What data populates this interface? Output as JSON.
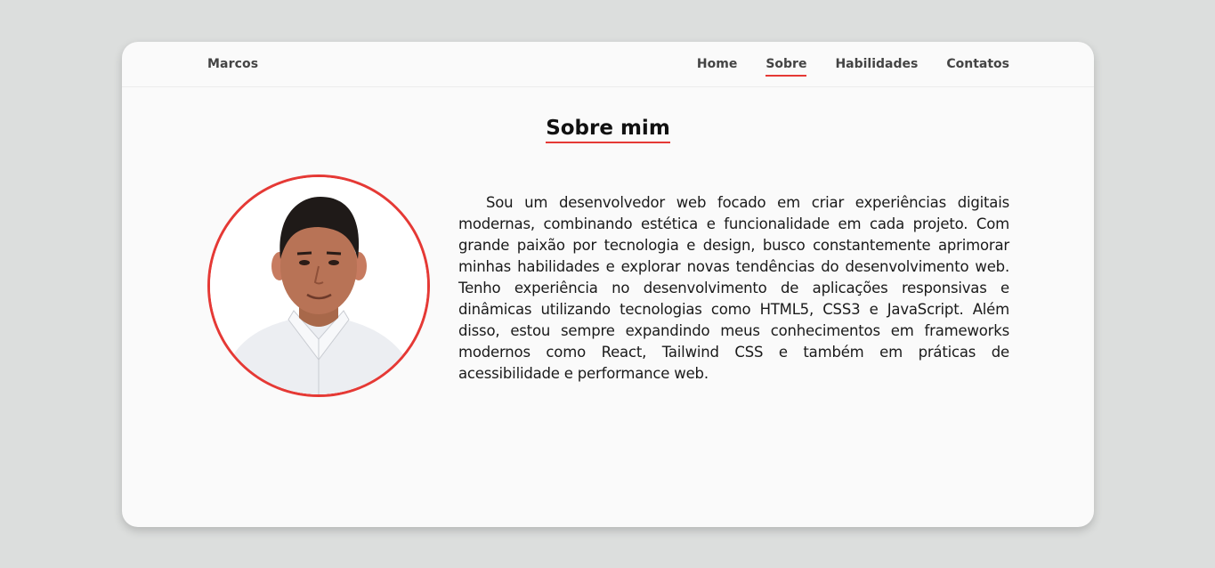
{
  "header": {
    "brand": "Marcos",
    "nav": [
      {
        "label": "Home",
        "active": false
      },
      {
        "label": "Sobre",
        "active": true
      },
      {
        "label": "Habilidades",
        "active": false
      },
      {
        "label": "Contatos",
        "active": false
      }
    ]
  },
  "main": {
    "title": "Sobre mim",
    "about_text": "Sou um desenvolvedor web focado em criar experiências digitais modernas, combinando estética e funcionalidade em cada projeto. Com grande paixão por tecnologia e design, busco constantemente aprimorar minhas habilidades e explorar novas tendências do desenvolvimento web. Tenho experiência no desenvolvimento de aplicações responsivas e dinâmicas utilizando tecnologias como HTML5, CSS3 e JavaScript. Além disso, estou sempre expandindo meus conhecimentos em frameworks modernos como React, Tailwind CSS e também em práticas de acessibilidade e performance web."
  },
  "colors": {
    "accent": "#e53935",
    "background": "#dcdedd",
    "card": "#fafafa",
    "text": "#1a1a1a",
    "nav_text": "#444444"
  }
}
